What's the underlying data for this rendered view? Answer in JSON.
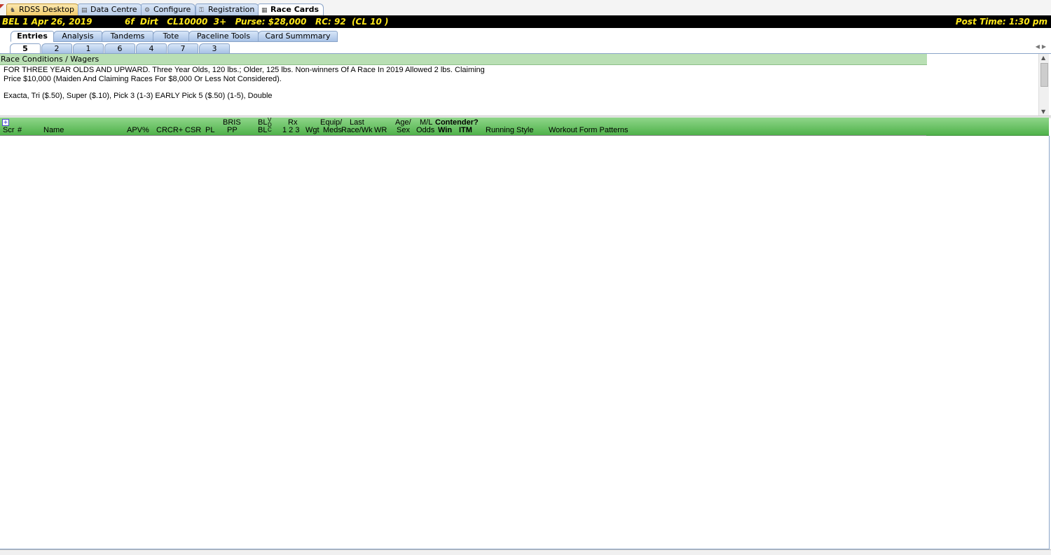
{
  "app_tabs": [
    {
      "label": "RDSS Desktop",
      "icon": "horse-icon"
    },
    {
      "label": "Data Centre",
      "icon": "database-icon"
    },
    {
      "label": "Configure",
      "icon": "gear-icon"
    },
    {
      "label": "Registration",
      "icon": "key-icon"
    },
    {
      "label": "Race Cards",
      "icon": "grid-icon"
    }
  ],
  "race_bar": {
    "left": "BEL  1  Apr 26, 2019",
    "middle": "6f  Dirt   CL10000  3+   Purse: $28,000   RC: 92  (CL 10 )",
    "right": "Post Time: 1:30 pm"
  },
  "sub_tabs": [
    "Entries",
    "Analysis",
    "Tandems",
    "Tote",
    "Paceline Tools",
    "Card Summmary"
  ],
  "race_tabs": [
    "5",
    "2",
    "1",
    "6",
    "4",
    "7",
    "3"
  ],
  "conditions": {
    "header": "Race Conditions / Wagers",
    "line1": "FOR THREE YEAR OLDS AND UPWARD. Three Year Olds, 120 lbs.; Older, 125 lbs. Non-winners Of A Race In 2019 Allowed 2 lbs. Claiming",
    "line2": "Price $10,000 (Maiden And Claiming Races For $8,000 Or Less Not Considered).",
    "wagers": "Exacta, Tri ($.50), Super ($.10), Pick 3  (1-3) EARLY Pick 5 ($.50)  (1-5), Double"
  },
  "grid_headers": {
    "scr": "Scr",
    "num": "#",
    "name": "Name",
    "apv": "APV%",
    "crcr": "CRCR+",
    "csr": "CSR",
    "pl": "PL",
    "bris_top": "BRIS",
    "bris_bot": "PP",
    "bl_top": "BL",
    "bl_bot": "BL",
    "v": "V",
    "d": "D",
    "c": "C",
    "rx_top": "Rx",
    "rx_bot": "1  2  3",
    "wgt": "Wgt",
    "equip_top": "Equip/",
    "equip_bot": "Meds",
    "last_top": "Last",
    "last_bot": "Race/Wk",
    "wr": "WR",
    "age_top": "Age/",
    "age_bot": "Sex",
    "ml_top": "M/L",
    "ml_bot": "Odds",
    "contender": "Contender?",
    "win": "Win",
    "itm": "ITM",
    "running_style": "Running Style",
    "workout": "Workout Form Patterns"
  }
}
